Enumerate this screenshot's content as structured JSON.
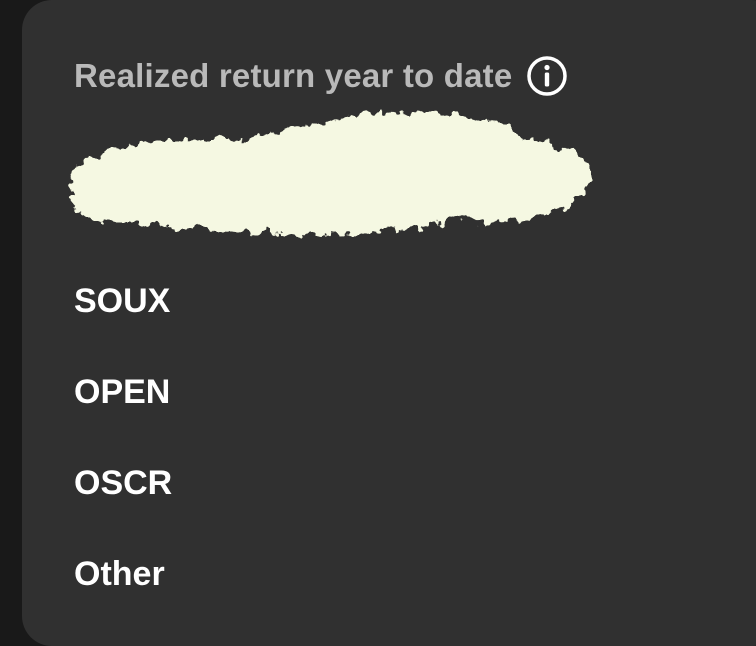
{
  "panel": {
    "title": "Realized return year to date",
    "info_icon": "info-circle-icon",
    "redacted_value_color": "#f5f8e2"
  },
  "holdings": [
    {
      "label": "SOUX"
    },
    {
      "label": "OPEN"
    },
    {
      "label": "OSCR"
    },
    {
      "label": "Other"
    }
  ],
  "colors": {
    "background": "#191919",
    "card": "#303030",
    "title": "#b9b9b9",
    "item_text": "#ffffff"
  }
}
